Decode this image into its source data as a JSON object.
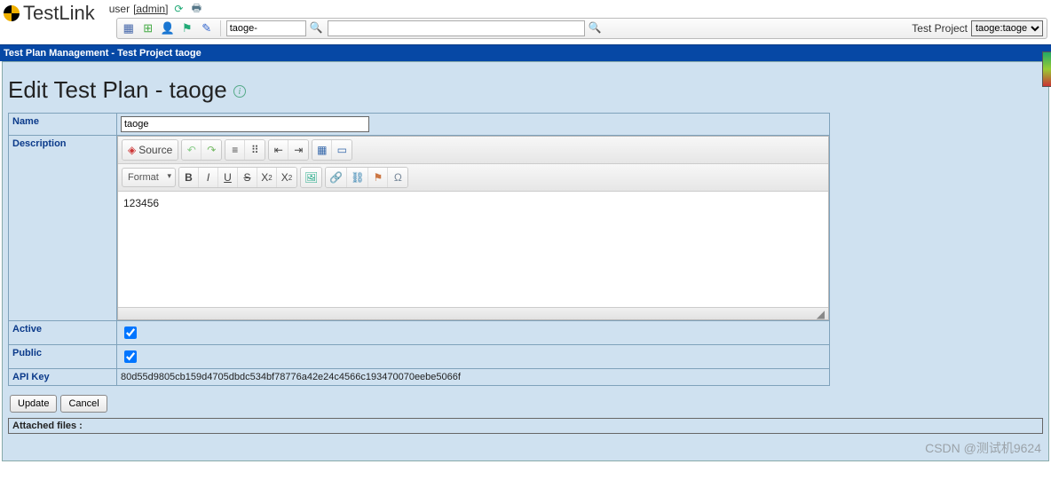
{
  "app": {
    "name": "TestLink"
  },
  "header": {
    "user_label": "user",
    "user_name": "[admin]"
  },
  "toolbar": {
    "search_short_value": "taoge-",
    "search_long_value": "",
    "test_project_label": "Test Project",
    "test_project_selected": "taoge:taoge"
  },
  "bluebar": {
    "text": "Test Plan Management - Test Project taoge"
  },
  "page": {
    "title": "Edit Test Plan - taoge"
  },
  "form": {
    "labels": {
      "name": "Name",
      "description": "Description",
      "active": "Active",
      "public": "Public",
      "api_key": "API Key"
    },
    "name_value": "taoge",
    "active_checked": true,
    "public_checked": true,
    "api_key": "80d55d9805cb159d4705dbdc534bf78776a42e24c4566c193470070eebe5066f"
  },
  "editor": {
    "source_label": "Source",
    "format_label": "Format",
    "body": "123456"
  },
  "buttons": {
    "update": "Update",
    "cancel": "Cancel"
  },
  "attach": {
    "label": "Attached files :"
  },
  "watermark": "CSDN @测试机9624"
}
